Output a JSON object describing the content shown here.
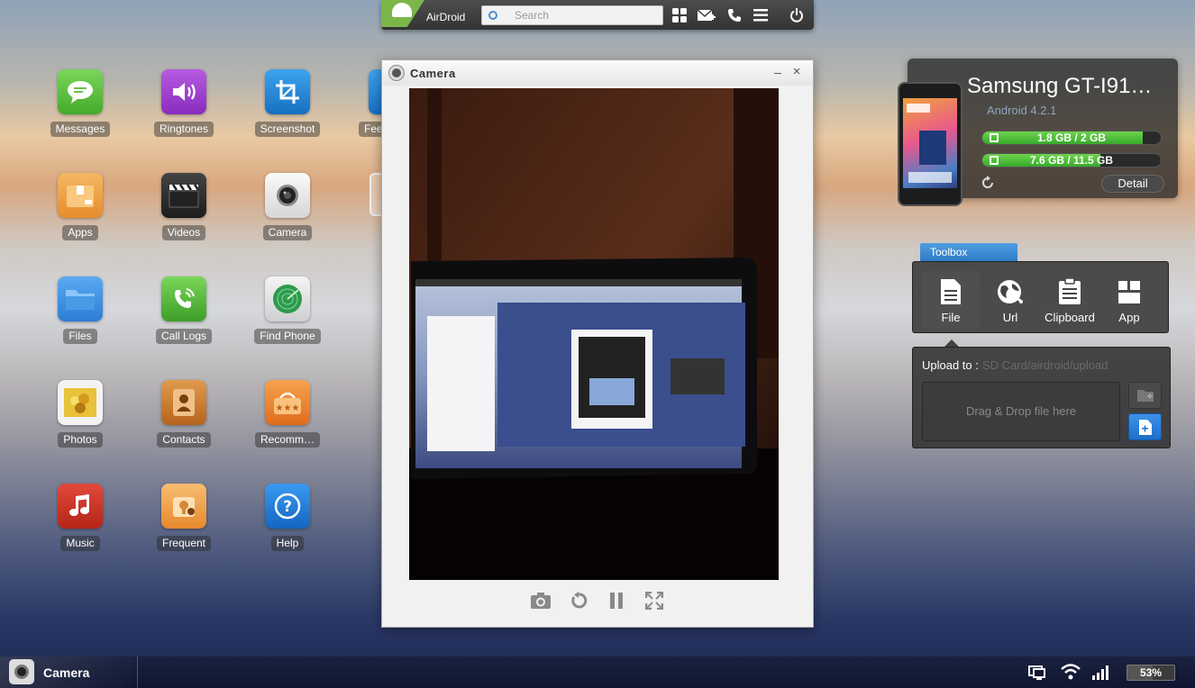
{
  "topbar": {
    "logo_text": "AirDroid",
    "search_placeholder": "Search",
    "buttons": [
      "apps-grid-icon",
      "new-message-icon",
      "phone-icon",
      "menu-icon",
      "power-icon"
    ]
  },
  "desktop": {
    "apps": [
      {
        "label": "Messages",
        "icon": "messages-icon",
        "color": "#5cc13b"
      },
      {
        "label": "Ringtones",
        "icon": "ringtones-icon",
        "color": "#9b3fcf"
      },
      {
        "label": "Screenshot",
        "icon": "screenshot-icon",
        "color": "#1f88d8"
      },
      {
        "label": "Fee",
        "icon": "feedback-icon",
        "color": "#1f88d8"
      },
      {
        "label": "Apps",
        "icon": "apps-package-icon",
        "color": "#f0a142"
      },
      {
        "label": "Videos",
        "icon": "videos-icon",
        "color": "#2b2b2b"
      },
      {
        "label": "Camera",
        "icon": "camera-icon",
        "color": "#e8e8e8"
      },
      {
        "label": "Files",
        "icon": "files-folder-icon",
        "color": "#3c8de0"
      },
      {
        "label": "Call Logs",
        "icon": "call-logs-icon",
        "color": "#51b838"
      },
      {
        "label": "Find Phone",
        "icon": "find-phone-radar-icon",
        "color": "#2a9a4a"
      },
      {
        "label": "Photos",
        "icon": "photos-icon",
        "color": "#f2f2f2"
      },
      {
        "label": "Contacts",
        "icon": "contacts-icon",
        "color": "#c97a2e"
      },
      {
        "label": "Recomm…",
        "icon": "recommend-basket-icon",
        "color": "#ef8a2e"
      },
      {
        "label": "Music",
        "icon": "music-note-icon",
        "color": "#d33a2a"
      },
      {
        "label": "Frequent",
        "icon": "frequent-contacts-icon",
        "color": "#f0a142"
      },
      {
        "label": "Help",
        "icon": "help-question-icon",
        "color": "#2586d8"
      }
    ]
  },
  "camera_window": {
    "title": "Camera",
    "minimize": "–",
    "close": "×"
  },
  "device": {
    "name": "Samsung GT-I91…",
    "os": "Android 4.2.1",
    "storage": [
      {
        "text": "1.8 GB / 2 GB",
        "fraction": 0.9,
        "icon": "phone-storage-icon"
      },
      {
        "text": "7.6 GB / 11.5 GB",
        "fraction": 0.66,
        "icon": "sd-card-icon"
      }
    ],
    "detail_label": "Detail"
  },
  "toolbox": {
    "tab_label": "Toolbox",
    "tools": [
      {
        "label": "File",
        "icon": "file-icon",
        "active": true
      },
      {
        "label": "Url",
        "icon": "url-globe-icon",
        "active": false
      },
      {
        "label": "Clipboard",
        "icon": "clipboard-icon",
        "active": false
      },
      {
        "label": "App",
        "icon": "app-box-icon",
        "active": false
      }
    ],
    "upload_to_label": "Upload to :",
    "upload_path": "SD Card/airdroid/upload",
    "dropzone_text": "Drag & Drop file here"
  },
  "taskbar": {
    "active_task": "Camera",
    "battery_percent": "53%",
    "battery_level": 0.53
  }
}
